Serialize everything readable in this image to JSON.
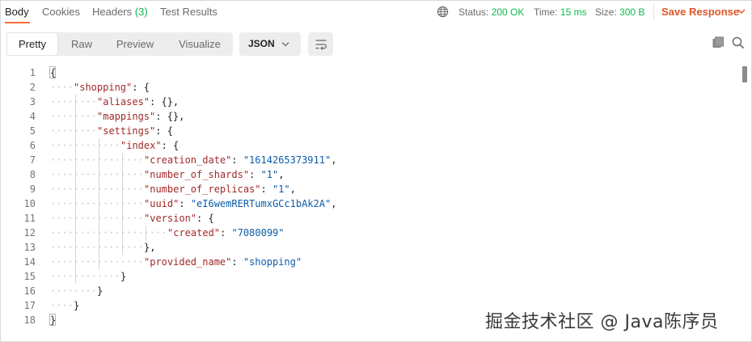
{
  "tabs": [
    {
      "label": "Body"
    },
    {
      "label": "Cookies"
    },
    {
      "label": "Headers",
      "count": "(3)"
    },
    {
      "label": "Test Results"
    }
  ],
  "status": {
    "status_label": "Status:",
    "status_value": "200 OK",
    "time_label": "Time:",
    "time_value": "15 ms",
    "size_label": "Size:",
    "size_value": "300 B"
  },
  "save_response": "Save Response",
  "view_modes": [
    "Pretty",
    "Raw",
    "Preview",
    "Visualize"
  ],
  "active_view": "Pretty",
  "format": "JSON",
  "icons": {
    "globe": "globe-icon",
    "chevron": "chevron-down-icon",
    "wrap": "word-wrap-icon",
    "copy": "copy-icon",
    "search": "search-icon"
  },
  "colors": {
    "accent": "#ff6c37",
    "save": "#e0552b",
    "status_ok": "#0cbb52",
    "json_key": "#a12a2a",
    "json_string": "#0b5ca8"
  },
  "code_lines": [
    {
      "n": "1",
      "text": "{"
    },
    {
      "n": "2",
      "text": "\"shopping\": {"
    },
    {
      "n": "3",
      "text": "\"aliases\": {},"
    },
    {
      "n": "4",
      "text": "\"mappings\": {},"
    },
    {
      "n": "5",
      "text": "\"settings\": {"
    },
    {
      "n": "6",
      "text": "\"index\": {"
    },
    {
      "n": "7",
      "text": "\"creation_date\": \"1614265373911\","
    },
    {
      "n": "8",
      "text": "\"number_of_shards\": \"1\","
    },
    {
      "n": "9",
      "text": "\"number_of_replicas\": \"1\","
    },
    {
      "n": "10",
      "text": "\"uuid\": \"eI6wemRERTumxGCc1bAk2A\","
    },
    {
      "n": "11",
      "text": "\"version\": {"
    },
    {
      "n": "12",
      "text": "\"created\": \"7080099\""
    },
    {
      "n": "13",
      "text": "},"
    },
    {
      "n": "14",
      "text": "\"provided_name\": \"shopping\""
    },
    {
      "n": "15",
      "text": "}"
    },
    {
      "n": "16",
      "text": "}"
    },
    {
      "n": "17",
      "text": "}"
    },
    {
      "n": "18",
      "text": "}"
    }
  ],
  "watermark": "掘金技术社区 @ Java陈序员"
}
